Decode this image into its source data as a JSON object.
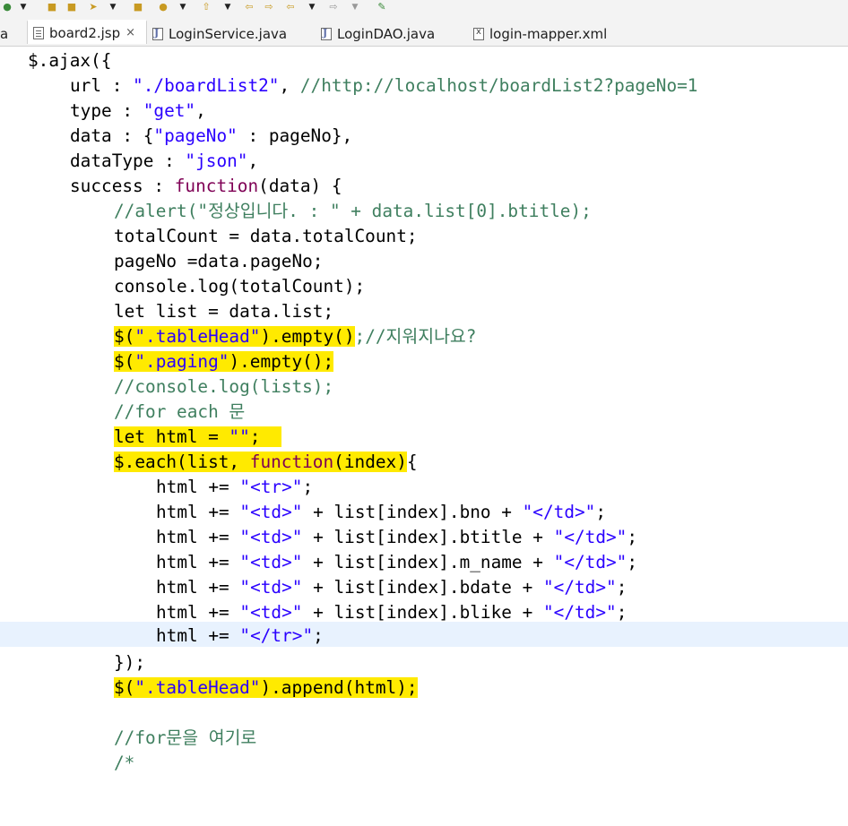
{
  "tabs": [
    {
      "label": "a",
      "type": "partial",
      "active": false
    },
    {
      "label": "board2.jsp",
      "type": "jsp",
      "active": true,
      "close": "×"
    },
    {
      "label": "LoginService.java",
      "type": "java",
      "active": false
    },
    {
      "label": "LoginDAO.java",
      "type": "java",
      "active": false
    },
    {
      "label": "login-mapper.xml",
      "type": "xml",
      "active": false
    }
  ],
  "code": {
    "l0": {
      "t0": "$.ajax({"
    },
    "l1": {
      "t0": "url : ",
      "t1": "\"./boardList2\"",
      "t2": ", ",
      "t3": "//http://localhost/boardList2?pageNo=1"
    },
    "l2": {
      "t0": "type : ",
      "t1": "\"get\"",
      "t2": ","
    },
    "l3": {
      "t0": "data : {",
      "t1": "\"pageNo\"",
      "t2": " : pageNo},"
    },
    "l4": {
      "t0": "dataType : ",
      "t1": "\"json\"",
      "t2": ","
    },
    "l5": {
      "t0": "success : ",
      "t1": "function",
      "t2": "(data) {"
    },
    "l6": {
      "t0": "//alert(\"정상입니다. : \" + data.list[0].btitle);"
    },
    "l7": {
      "t0": "totalCount = data.totalCount;"
    },
    "l8": {
      "t0": "pageNo =data.pageNo;"
    },
    "l9": {
      "t0": "console.log(totalCount);"
    },
    "l10": {
      "t0": "let list = data.list;"
    },
    "l11": {
      "t0": "$(",
      "t1": "\".tableHead\"",
      "t2": ").empty()",
      "t3": ";//지워지나요?"
    },
    "l12": {
      "t0": "$(",
      "t1": "\".paging\"",
      "t2": ").empty();"
    },
    "l13": {
      "t0": "//console.log(lists);"
    },
    "l14": {
      "t0": "//for each 문"
    },
    "l15": {
      "t0": "let html = ",
      "t1": "\"\"",
      "t2": ";"
    },
    "l16": {
      "t0": "$.each(list, ",
      "t1": "function",
      "t2": "(index)",
      "t3": "{"
    },
    "l17": {
      "t0": "html += ",
      "t1": "\"<tr>\"",
      "t2": ";"
    },
    "l18": {
      "t0": "html += ",
      "t1": "\"<td>\"",
      "t2": " + list[index].bno + ",
      "t3": "\"</td>\"",
      "t4": ";"
    },
    "l19": {
      "t0": "html += ",
      "t1": "\"<td>\"",
      "t2": " + list[index].btitle + ",
      "t3": "\"</td>\"",
      "t4": ";"
    },
    "l20": {
      "t0": "html += ",
      "t1": "\"<td>\"",
      "t2": " + list[index].m_name + ",
      "t3": "\"</td>\"",
      "t4": ";"
    },
    "l21": {
      "t0": "html += ",
      "t1": "\"<td>\"",
      "t2": " + list[index].bdate + ",
      "t3": "\"</td>\"",
      "t4": ";"
    },
    "l22": {
      "t0": "html += ",
      "t1": "\"<td>\"",
      "t2": " + list[index].blike + ",
      "t3": "\"</td>\"",
      "t4": ";"
    },
    "l23": {
      "t0": "html += ",
      "t1": "\"</tr>\"",
      "t2": ";"
    },
    "l24": {
      "t0": "});"
    },
    "l25": {
      "t0": "$(",
      "t1": "\".tableHead\"",
      "t2": ").append(html);"
    },
    "l26": {
      "t0": ""
    },
    "l27": {
      "t0": "//for문을 여기로"
    },
    "l28": {
      "t0": "/*"
    }
  },
  "colors": {
    "string": "#2a00ff",
    "comment": "#3f7f5f",
    "keyword": "#7f0055",
    "highlight": "#ffea00",
    "current_line": "#e8f2fe"
  },
  "icons": [
    "run-icon",
    "toolbar-dropdown-icon",
    "open-folder-icon",
    "pin-icon",
    "package-icon",
    "search-icon",
    "up-arrow-icon",
    "back-arrow-icon",
    "forward-arrow-icon",
    "external-icon"
  ]
}
